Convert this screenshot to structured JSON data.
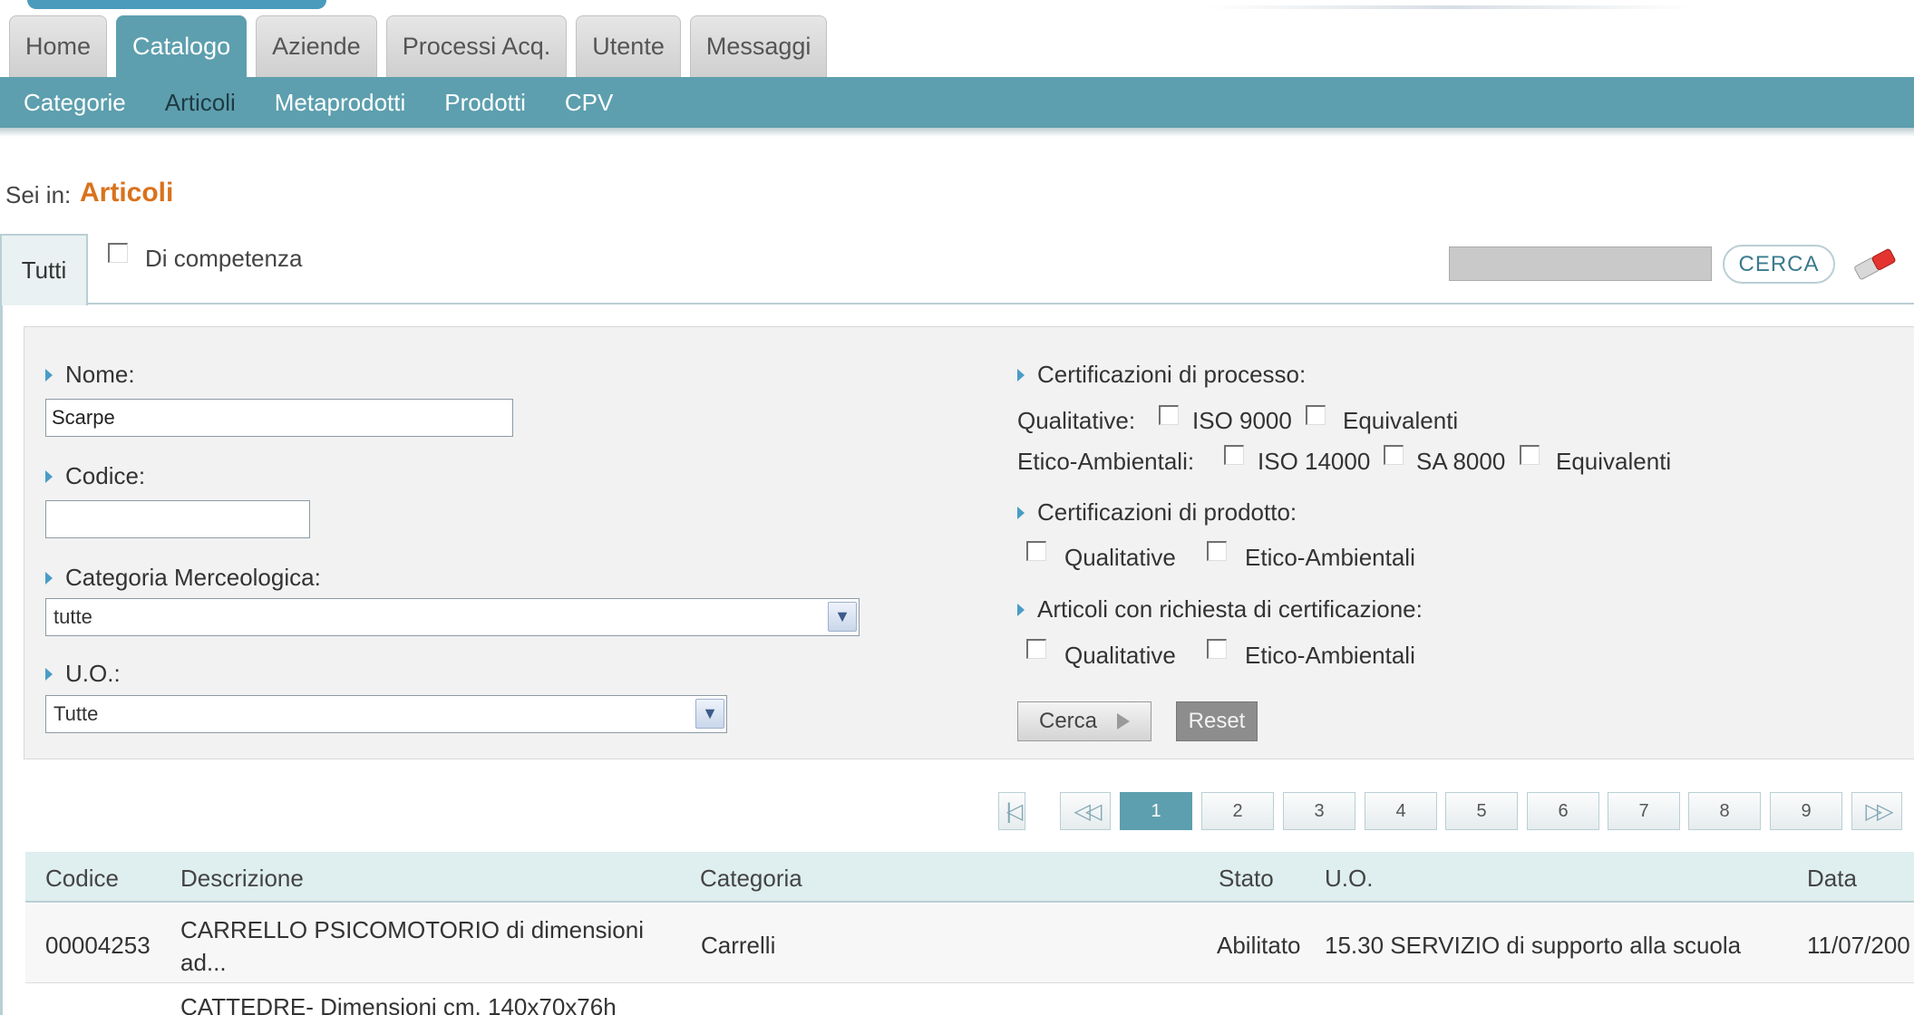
{
  "top_tabs": [
    "Home",
    "Catalogo",
    "Aziende",
    "Processi Acq.",
    "Utente",
    "Messaggi"
  ],
  "active_top_tab": "Catalogo",
  "sub_nav": [
    "Categorie",
    "Articoli",
    "Metaprodotti",
    "Prodotti",
    "CPV"
  ],
  "active_sub_nav": "Articoli",
  "breadcrumb": {
    "label": "Sei in:",
    "value": "Articoli"
  },
  "mode_tabs": {
    "all": "Tutti",
    "competenza_label": "Di competenza"
  },
  "quick_search": {
    "value": "",
    "button": "CERCA",
    "clear_icon": "eraser-icon"
  },
  "filters": {
    "nome_label": "Nome:",
    "nome_value": "Scarpe",
    "codice_label": "Codice:",
    "codice_value": "",
    "categoria_label": "Categoria Merceologica:",
    "categoria_value": "tutte",
    "uo_label": "U.O.:",
    "uo_value": "Tutte",
    "cert_processo_label": "Certificazioni di processo:",
    "qualitative_label": "Qualitative:",
    "iso9000": "ISO 9000",
    "equivalenti": "Equivalenti",
    "etico_label": "Etico-Ambientali:",
    "iso14000": "ISO 14000",
    "sa8000": "SA 8000",
    "cert_prodotto_label": "Certificazioni di prodotto:",
    "opt_qualitative": "Qualitative",
    "opt_etico": "Etico-Ambientali",
    "richiesta_label": "Articoli con richiesta di certificazione:",
    "cerca_button": "Cerca",
    "reset_button": "Reset"
  },
  "pagination": {
    "current": "1",
    "pages": [
      "1",
      "2",
      "3",
      "4",
      "5",
      "6",
      "7",
      "8",
      "9"
    ]
  },
  "table": {
    "columns": [
      "Codice",
      "Descrizione",
      "Categoria",
      "Stato",
      "U.O.",
      "Data"
    ],
    "rows": [
      {
        "codice": "00004253",
        "descrizione_1": "CARRELLO PSICOMOTORIO di dimensioni",
        "descrizione_2": "ad...",
        "categoria": "Carrelli",
        "stato": "Abilitato",
        "uo": "15.30 SERVIZIO di supporto alla scuola",
        "data": "11/07/200"
      },
      {
        "codice": "",
        "descrizione_1": "CATTEDRE- Dimensioni cm. 140x70x76h",
        "descrizione_2": "",
        "categoria": "",
        "stato": "",
        "uo": "",
        "data": ""
      }
    ]
  },
  "colors": {
    "accent": "#5d9fae",
    "breadcrumb": "#d9721c",
    "panel": "#f2f2f2"
  }
}
